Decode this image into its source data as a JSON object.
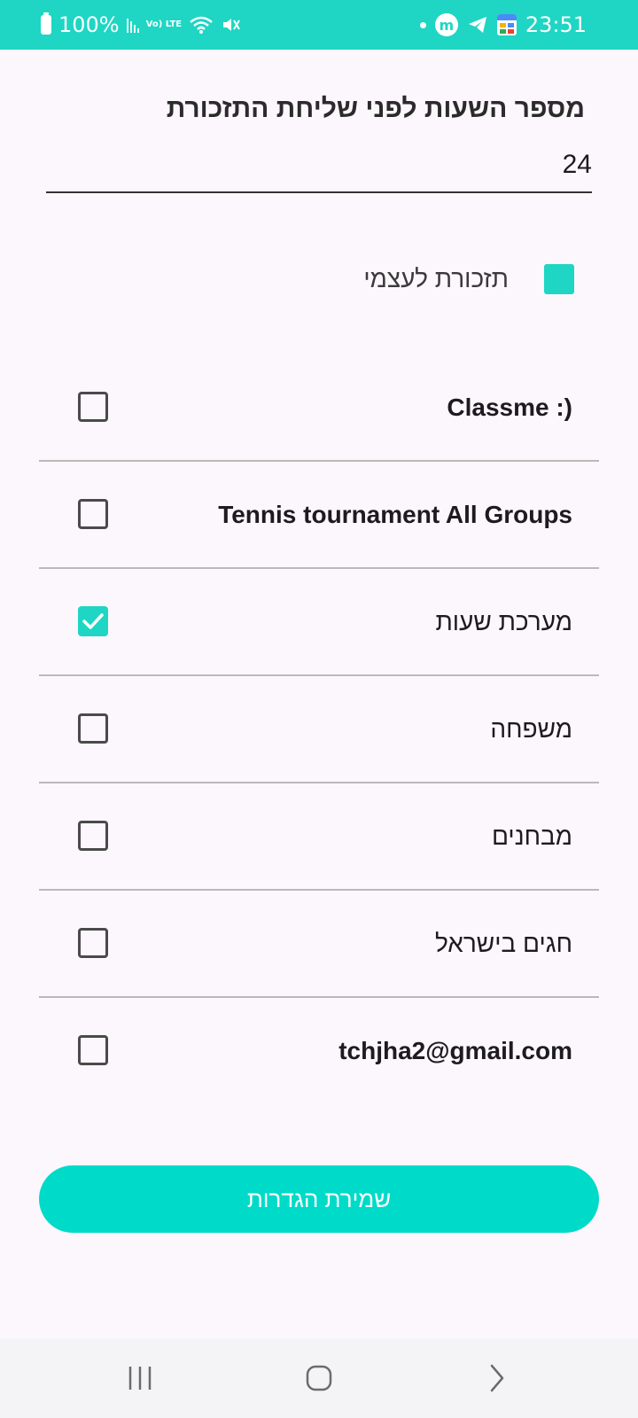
{
  "status_bar": {
    "battery": "100%",
    "volte": "Vo) LTE",
    "m_badge": "m",
    "time": "23:51"
  },
  "settings": {
    "title": "מספר השעות לפני שליחת התזכורת",
    "hours_value": "24",
    "self_reminder_label": "תזכורת לעצמי"
  },
  "calendars": [
    {
      "name": "Classme :)",
      "checked": false
    },
    {
      "name": "Tennis tournament All Groups",
      "checked": false
    },
    {
      "name": "מערכת שעות",
      "checked": true
    },
    {
      "name": "משפחה",
      "checked": false
    },
    {
      "name": "מבחנים",
      "checked": false
    },
    {
      "name": "חגים בישראל",
      "checked": false
    },
    {
      "name": "tchjha2@gmail.com",
      "checked": false
    }
  ],
  "save_button_label": "שמירת הגדרות",
  "colors": {
    "accent": "#1ed6c3",
    "button": "#00dbc9",
    "background": "#fcf7fd",
    "divider": "#b9b9b9"
  },
  "icons": {
    "nav_recents": "recents-icon",
    "nav_home": "home-icon",
    "nav_back": "back-icon"
  }
}
